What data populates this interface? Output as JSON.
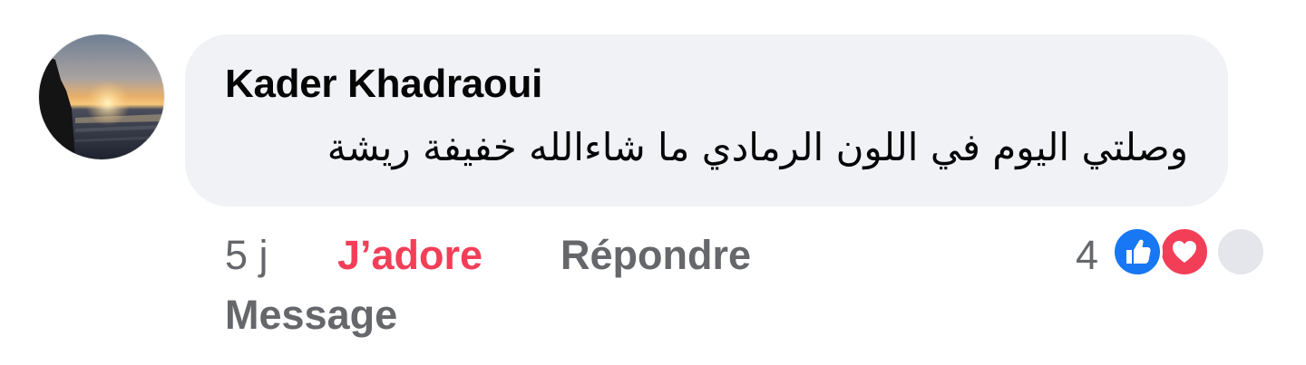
{
  "comment": {
    "author": "Kader Khadraoui",
    "text": "وصلتي اليوم في اللون الرمادي ما شاءالله خفيفة ريشة",
    "timestamp": "5 j",
    "react_label": "J’adore",
    "reply_label": "Répondre",
    "message_label": "Message",
    "reaction_count": "4",
    "reactions": [
      "like-icon",
      "love-icon",
      "more-reactions-icon"
    ]
  },
  "colors": {
    "bubble_bg": "#f0f2f5",
    "author_text": "#050505",
    "muted_text": "#65676b",
    "love_accent": "#f33e58",
    "like_blue": "#1877f2"
  }
}
